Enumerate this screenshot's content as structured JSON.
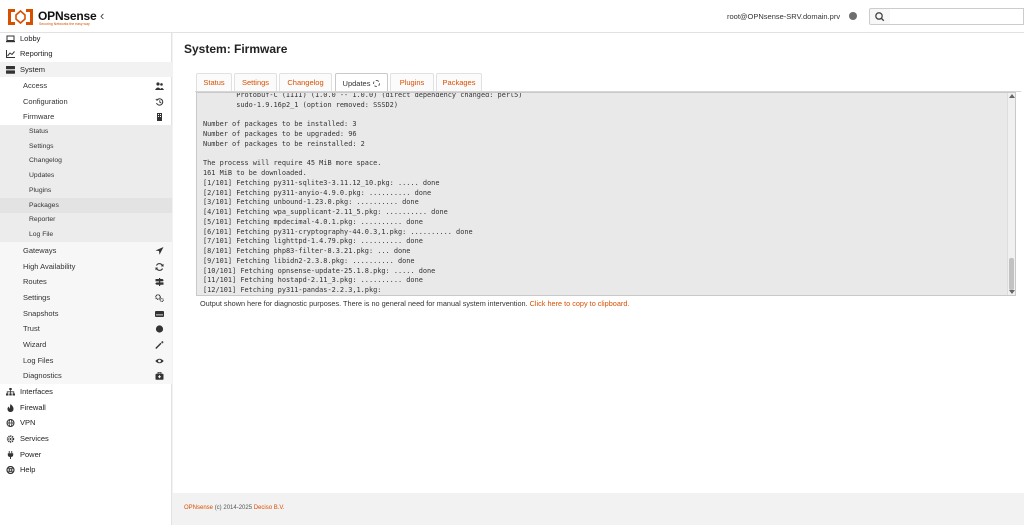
{
  "brand": {
    "name": "OPNsense",
    "tagline": "Securing Networks the easy way",
    "accent_color": "#d94f00"
  },
  "header": {
    "user": "root@OPNsense-SRV.domain.prv",
    "search": {
      "value": "",
      "placeholder": ""
    }
  },
  "sidebar": {
    "lobby": "Lobby",
    "reporting": "Reporting",
    "system": "System",
    "system_items": {
      "access": "Access",
      "configuration": "Configuration",
      "firmware": "Firmware",
      "gateways": "Gateways",
      "high_availability": "High Availability",
      "routes": "Routes",
      "settings": "Settings",
      "snapshots": "Snapshots",
      "trust": "Trust",
      "wizard": "Wizard",
      "log_files": "Log Files",
      "diagnostics": "Diagnostics"
    },
    "firmware_items": {
      "status": "Status",
      "settings": "Settings",
      "changelog": "Changelog",
      "updates": "Updates",
      "plugins": "Plugins",
      "packages": "Packages",
      "reporter": "Reporter",
      "log_file": "Log File"
    },
    "interfaces": "Interfaces",
    "firewall": "Firewall",
    "vpn": "VPN",
    "services": "Services",
    "power": "Power",
    "help": "Help",
    "active_item": "Packages"
  },
  "page": {
    "title": "System: Firmware",
    "tabs": {
      "status": "Status",
      "settings": "Settings",
      "changelog": "Changelog",
      "updates": "Updates",
      "plugins": "Plugins",
      "packages": "Packages"
    },
    "active_tab": "Updates",
    "console_lines": [
      "        Protobuf-C (IIII) (1.0.0 -- 1.0.0) (direct dependency changed: perl5)",
      "        sudo-1.9.16p2_1 (option removed: SSSD2)",
      "",
      "Number of packages to be installed: 3",
      "Number of packages to be upgraded: 96",
      "Number of packages to be reinstalled: 2",
      "",
      "The process will require 45 MiB more space.",
      "161 MiB to be downloaded.",
      "[1/101] Fetching py311-sqlite3-3.11.12_10.pkg: ..... done",
      "[2/101] Fetching py311-anyio-4.9.0.pkg: .......... done",
      "[3/101] Fetching unbound-1.23.0.pkg: .......... done",
      "[4/101] Fetching wpa_supplicant-2.11_5.pkg: .......... done",
      "[5/101] Fetching mpdecimal-4.0.1.pkg: .......... done",
      "[6/101] Fetching py311-cryptography-44.0.3,1.pkg: .......... done",
      "[7/101] Fetching lighttpd-1.4.79.pkg: .......... done",
      "[8/101] Fetching php83-filter-8.3.21.pkg: ... done",
      "[9/101] Fetching libidn2-2.3.8.pkg: .......... done",
      "[10/101] Fetching opnsense-update-25.1.8.pkg: ..... done",
      "[11/101] Fetching hostapd-2.11_3.pkg: .......... done",
      "[12/101] Fetching py311-pandas-2.2.3,1.pkg:"
    ],
    "note_text": "Output shown here for diagnostic purposes. There is no general need for manual system intervention.",
    "note_link": "Click here to copy to clipboard."
  },
  "footer": {
    "brand": "OPNsense",
    "copyright": "(c) 2014-2025",
    "vendor": "Deciso B.V."
  }
}
